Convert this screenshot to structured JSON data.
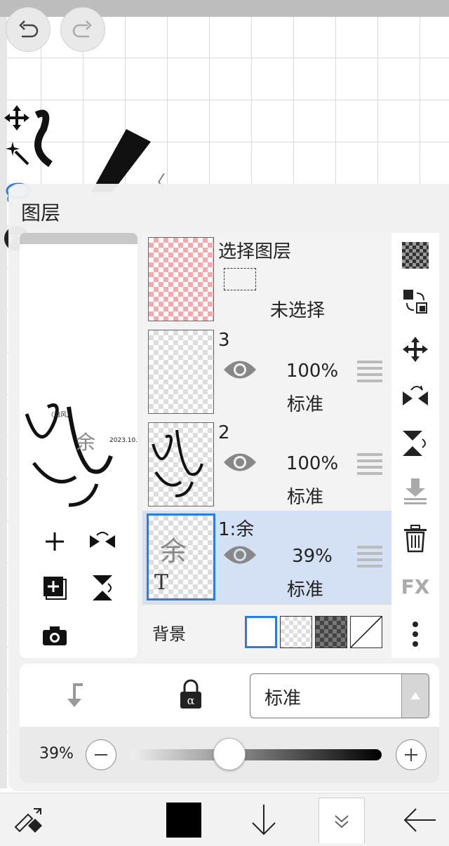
{
  "panel": {
    "title": "图层",
    "select_layer": {
      "title": "选择图层",
      "status": "未选择"
    },
    "layers": [
      {
        "name": "3",
        "opacity": "100%",
        "blend": "标准",
        "visible": true,
        "selected": false
      },
      {
        "name": "2",
        "opacity": "100%",
        "blend": "标准",
        "visible": true,
        "selected": false
      },
      {
        "name": "1:余",
        "opacity": "39%",
        "blend": "标准",
        "visible": true,
        "selected": true,
        "thumb_char": "余",
        "thumb_type": "T"
      }
    ],
    "background": {
      "label": "背景",
      "options": [
        "white",
        "checker-light",
        "checker-dark",
        "none"
      ],
      "selected": "white"
    },
    "right_tools": [
      "checker-icon",
      "swap-layers-icon",
      "move-icon",
      "flip-horizontal-icon",
      "flip-vertical-icon",
      "merge-down-icon",
      "trash-icon",
      "fx-icon",
      "more-icon"
    ],
    "fx_label": "FX",
    "preview_buttons": [
      "add-icon",
      "flip-horizontal-icon",
      "add-layer-icon",
      "flip-vertical-icon",
      "camera-icon"
    ]
  },
  "controls": {
    "blend_mode": "标准",
    "opacity_label": "39%",
    "opacity_value": 0.39
  },
  "toolbar": {
    "undo": "undo-icon",
    "redo": "redo-icon",
    "bottom": [
      "brush-swap-icon",
      "color-swatch",
      "arrow-down-icon",
      "collapse-icon",
      "back-arrow-icon"
    ],
    "color": "#000000"
  },
  "left_tools": {
    "fx_label": "FX"
  },
  "colors": {
    "accent": "#2e7be0",
    "selected_row": "#d4e1f5"
  }
}
